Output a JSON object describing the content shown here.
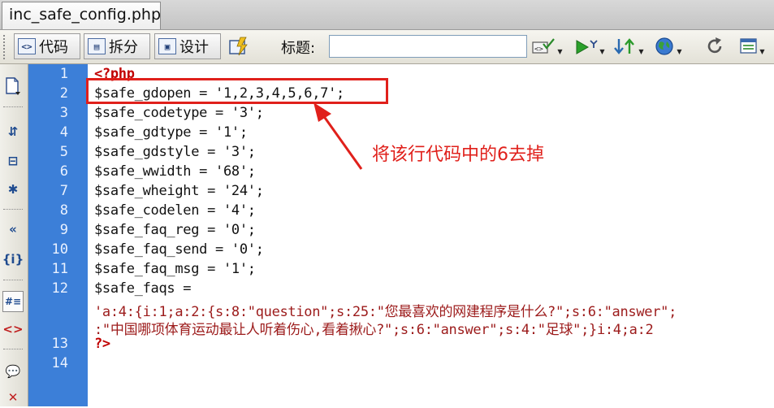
{
  "tab": {
    "filename": "inc_safe_config.php"
  },
  "toolbar": {
    "code_label": "代码",
    "split_label": "拆分",
    "design_label": "设计",
    "title_label": "标题:",
    "title_value": ""
  },
  "editor": {
    "line_numbers": [
      "1",
      "2",
      "3",
      "4",
      "5",
      "6",
      "7",
      "8",
      "9",
      "10",
      "11",
      "12",
      "",
      "",
      "13",
      "14"
    ],
    "lines": [
      "<?php",
      "$safe_gdopen = '1,2,3,4,5,6,7';",
      "$safe_codetype = '3';",
      "$safe_gdtype = '1';",
      "$safe_gdstyle = '3';",
      "$safe_wwidth = '68';",
      "$safe_wheight = '24';",
      "$safe_codelen = '4';",
      "$safe_faq_reg = '0';",
      "$safe_faq_send = '0';",
      "$safe_faq_msg = '1';",
      "$safe_faqs =",
      "'a:4:{i:1;a:2:{s:8:\"question\";s:25:\"您最喜欢的网建程序是什么?\";s:6:\"answer\";",
      ":\"中国哪项体育运动最让人听着伤心,看着揪心?\";s:6:\"answer\";s:4:\"足球\";}i:4;a:2",
      "?>",
      ""
    ]
  },
  "annotation": {
    "text": "将该行代码中的6去掉",
    "color": "#e0201b"
  },
  "colors": {
    "gutter": "#3c7fd8",
    "php_tag": "#c00000",
    "string": "#9c1b1b"
  }
}
